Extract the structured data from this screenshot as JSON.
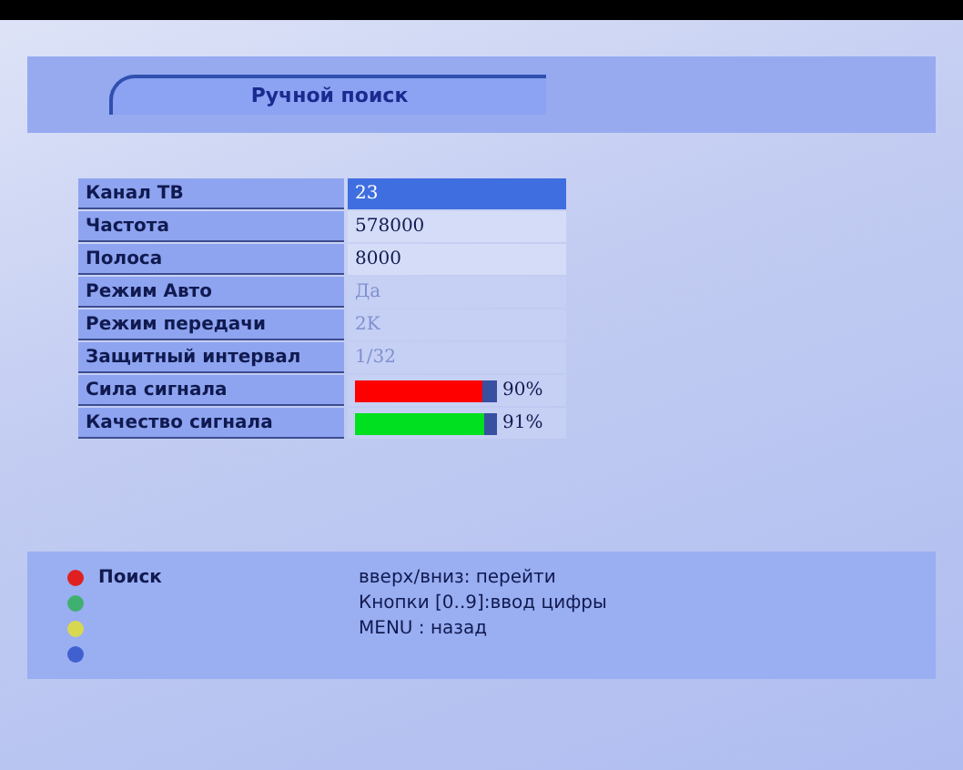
{
  "title": "Ручной поиск",
  "rows": [
    {
      "kind": "field",
      "label": "Канал ТВ",
      "value": "23",
      "selected": true,
      "disabled": false
    },
    {
      "kind": "field",
      "label": "Частота",
      "value": "578000",
      "selected": false,
      "disabled": false
    },
    {
      "kind": "field",
      "label": "Полоса",
      "value": "8000",
      "selected": false,
      "disabled": false
    },
    {
      "kind": "field",
      "label": "Режим Авто",
      "value": "Да",
      "selected": false,
      "disabled": true
    },
    {
      "kind": "field",
      "label": "Режим передачи",
      "value": "2K",
      "selected": false,
      "disabled": true
    },
    {
      "kind": "field",
      "label": "Защитный интервал",
      "value": "1/32",
      "selected": false,
      "disabled": true
    },
    {
      "kind": "bar",
      "label": "Сила сигнала",
      "level": 0.9,
      "reading": "90%",
      "color": "#ff0000"
    },
    {
      "kind": "bar",
      "label": "Качество сигнала",
      "level": 0.91,
      "reading": "91%",
      "color": "#00e020"
    }
  ],
  "color_keys": [
    {
      "color": "#e02020",
      "label": "Поиск"
    },
    {
      "color": "#40b070"
    },
    {
      "color": "#d8d850"
    },
    {
      "color": "#4060d0"
    }
  ],
  "help": [
    "вверх/вниз: перейти",
    "Кнопки [0..9]:ввод цифры",
    "MENU : назад"
  ]
}
